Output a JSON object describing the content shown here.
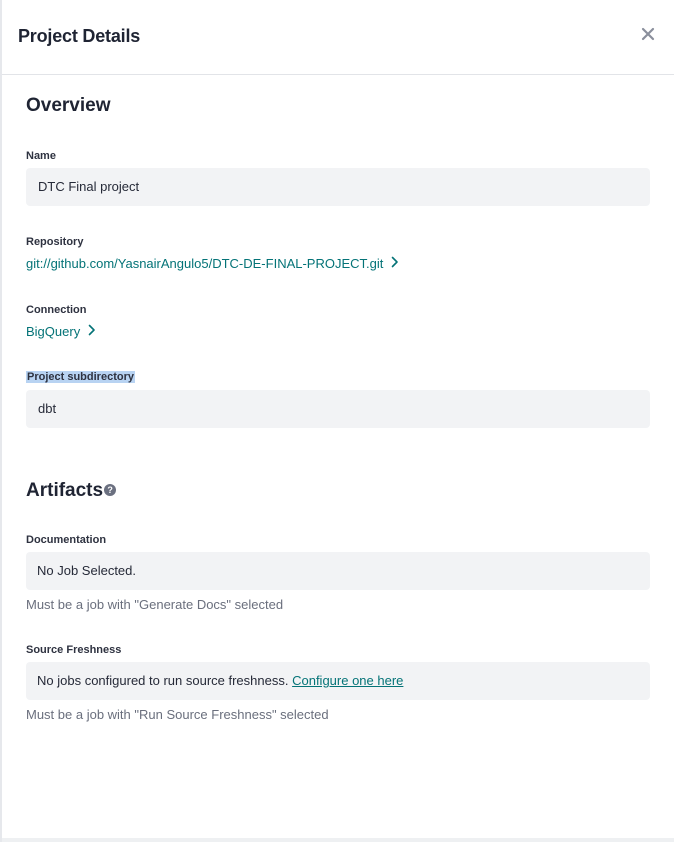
{
  "panel": {
    "title": "Project Details"
  },
  "overview": {
    "title": "Overview",
    "name": {
      "label": "Name",
      "value": "DTC Final project"
    },
    "repository": {
      "label": "Repository",
      "link": "git://github.com/YasnairAngulo5/DTC-DE-FINAL-PROJECT.git"
    },
    "connection": {
      "label": "Connection",
      "link": "BigQuery"
    },
    "subdirectory": {
      "label": "Project subdirectory",
      "value": "dbt"
    }
  },
  "artifacts": {
    "title": "Artifacts",
    "help_glyph": "?",
    "documentation": {
      "label": "Documentation",
      "value": "No Job Selected.",
      "help": "Must be a job with \"Generate Docs\" selected"
    },
    "source_freshness": {
      "label": "Source Freshness",
      "value": "No jobs configured to run source freshness.",
      "link": "Configure one here",
      "help": "Must be a job with \"Run Source Freshness\" selected"
    }
  },
  "icons": {
    "close": "close-icon",
    "chevron": "chevron-right-icon",
    "help": "help-icon"
  },
  "colors": {
    "link": "#047377",
    "field_bg": "#f2f3f5",
    "highlight": "#b8d3f2"
  }
}
